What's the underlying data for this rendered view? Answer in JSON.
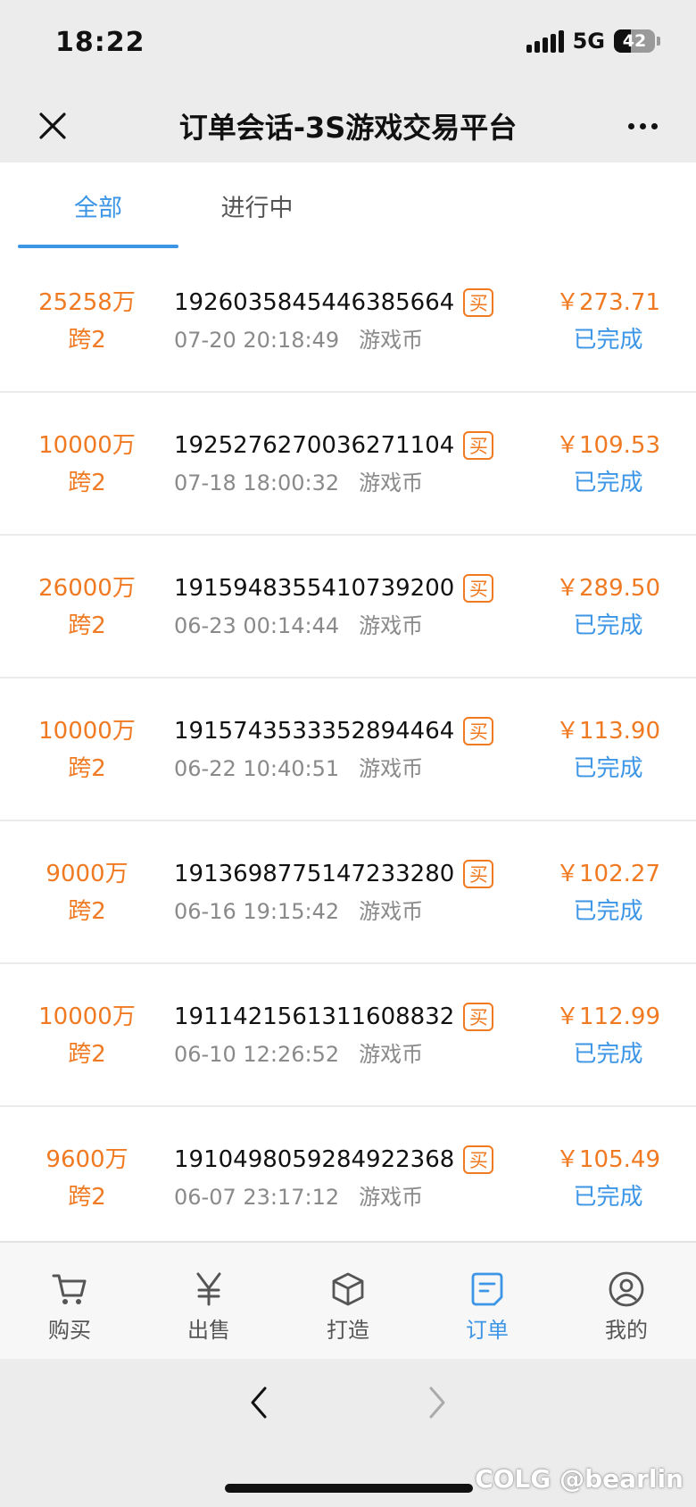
{
  "status_bar": {
    "time": "18:22",
    "network": "5G",
    "battery": "42",
    "battery_level": 0.42
  },
  "header": {
    "title": "订单会话-3S游戏交易平台"
  },
  "tabs": [
    {
      "label": "全部",
      "active": true
    },
    {
      "label": "进行中",
      "active": false
    }
  ],
  "orders": [
    {
      "amount": "25258万",
      "server": "跨2",
      "order_id": "1926035845446385664",
      "badge": "买",
      "datetime": "07-20 20:18:49",
      "category": "游戏币",
      "price": "￥273.71",
      "status": "已完成"
    },
    {
      "amount": "10000万",
      "server": "跨2",
      "order_id": "1925276270036271104",
      "badge": "买",
      "datetime": "07-18 18:00:32",
      "category": "游戏币",
      "price": "￥109.53",
      "status": "已完成"
    },
    {
      "amount": "26000万",
      "server": "跨2",
      "order_id": "1915948355410739200",
      "badge": "买",
      "datetime": "06-23 00:14:44",
      "category": "游戏币",
      "price": "￥289.50",
      "status": "已完成"
    },
    {
      "amount": "10000万",
      "server": "跨2",
      "order_id": "1915743533352894464",
      "badge": "买",
      "datetime": "06-22 10:40:51",
      "category": "游戏币",
      "price": "￥113.90",
      "status": "已完成"
    },
    {
      "amount": "9000万",
      "server": "跨2",
      "order_id": "1913698775147233280",
      "badge": "买",
      "datetime": "06-16 19:15:42",
      "category": "游戏币",
      "price": "￥102.27",
      "status": "已完成"
    },
    {
      "amount": "10000万",
      "server": "跨2",
      "order_id": "1911421561311608832",
      "badge": "买",
      "datetime": "06-10 12:26:52",
      "category": "游戏币",
      "price": "￥112.99",
      "status": "已完成"
    },
    {
      "amount": "9600万",
      "server": "跨2",
      "order_id": "1910498059284922368",
      "badge": "买",
      "datetime": "06-07 23:17:12",
      "category": "游戏币",
      "price": "￥105.49",
      "status": "已完成"
    }
  ],
  "bottom_nav": [
    {
      "label": "购买",
      "icon": "cart-icon",
      "active": false
    },
    {
      "label": "出售",
      "icon": "yen-icon",
      "active": false
    },
    {
      "label": "打造",
      "icon": "box-icon",
      "active": false
    },
    {
      "label": "订单",
      "icon": "order-icon",
      "active": true
    },
    {
      "label": "我的",
      "icon": "user-icon",
      "active": false
    }
  ],
  "watermark": "COLG @bearlin",
  "colors": {
    "accent_blue": "#3d95e6",
    "accent_orange": "#f07a22"
  }
}
